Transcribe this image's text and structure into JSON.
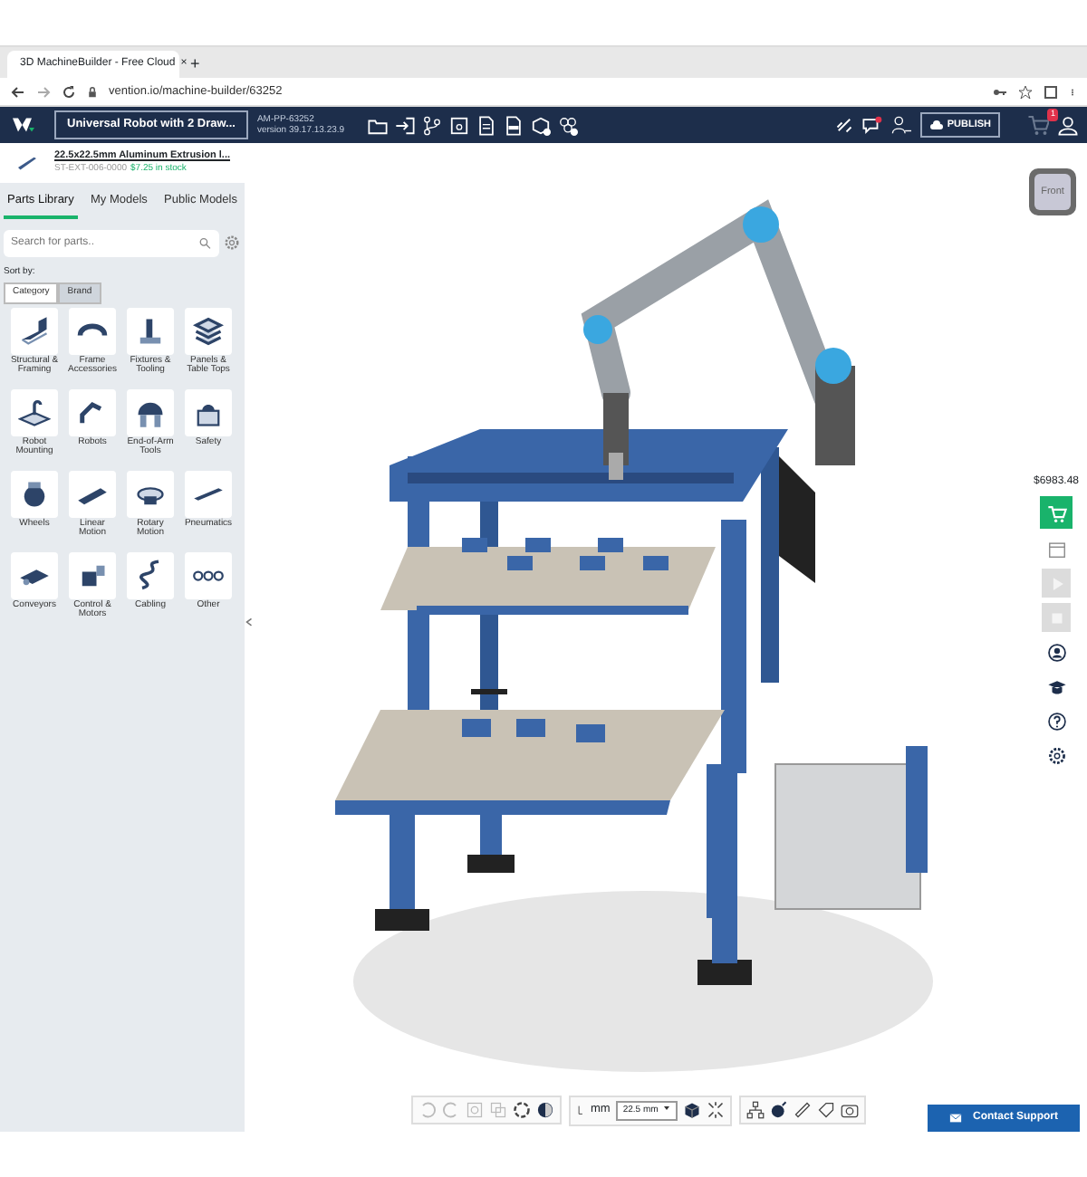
{
  "browser": {
    "tab_title": "3D MachineBuilder - Free Cloud",
    "tab_close": "×",
    "new_tab": "+",
    "url": "vention.io/machine-builder/63252"
  },
  "app_bar": {
    "project_name": "Universal Robot with 2 Draw...",
    "project_id": "AM-PP-63252",
    "version": "version 39.17.13.23.9",
    "publish": "PUBLISH",
    "cart_count": "1"
  },
  "part_banner": {
    "name": "22.5x22.5mm Aluminum Extrusion l...",
    "part_number": "ST-EXT-006-0000",
    "stock": "$7.25 in stock"
  },
  "sidebar": {
    "tabs": [
      {
        "label": "Parts Library",
        "selected": true
      },
      {
        "label": "My Models",
        "selected": false
      },
      {
        "label": "Public Models",
        "selected": false
      }
    ],
    "search": {
      "placeholder": "Search for parts.."
    },
    "sort_label": "Sort by:",
    "sort_options": [
      {
        "label": "Category",
        "selected": true
      },
      {
        "label": "Brand",
        "selected": false
      }
    ],
    "categories": [
      {
        "label": "Structural & Framing",
        "kind": "framing"
      },
      {
        "label": "Frame Accessories",
        "kind": "bracket"
      },
      {
        "label": "Fixtures & Tooling",
        "kind": "clamp"
      },
      {
        "label": "Panels & Table Tops",
        "kind": "panels"
      },
      {
        "label": "Robot Mounting",
        "kind": "mount"
      },
      {
        "label": "Robots",
        "kind": "robot"
      },
      {
        "label": "End-of-Arm Tools",
        "kind": "gripper"
      },
      {
        "label": "Safety",
        "kind": "safety"
      },
      {
        "label": "Wheels",
        "kind": "wheel"
      },
      {
        "label": "Linear Motion",
        "kind": "linear"
      },
      {
        "label": "Rotary Motion",
        "kind": "rotary"
      },
      {
        "label": "Pneumatics",
        "kind": "pneumatic"
      },
      {
        "label": "Conveyors",
        "kind": "conveyor"
      },
      {
        "label": "Control & Motors",
        "kind": "motor"
      },
      {
        "label": "Cabling",
        "kind": "cable"
      },
      {
        "label": "Other",
        "kind": "other"
      }
    ]
  },
  "viewport": {
    "view_cube": "Front",
    "total_price": "$6983.48",
    "side_tools": [
      {
        "kind": "cart",
        "disabled": false
      },
      {
        "kind": "document",
        "disabled": false
      },
      {
        "kind": "play",
        "disabled": true
      },
      {
        "kind": "stop",
        "disabled": true
      },
      {
        "kind": "user",
        "disabled": false
      },
      {
        "kind": "cap",
        "disabled": false
      },
      {
        "kind": "help",
        "disabled": false
      },
      {
        "kind": "settings",
        "disabled": false
      }
    ],
    "unit": "mm",
    "step_size": "22.5 mm",
    "contact": "Contact Support"
  }
}
